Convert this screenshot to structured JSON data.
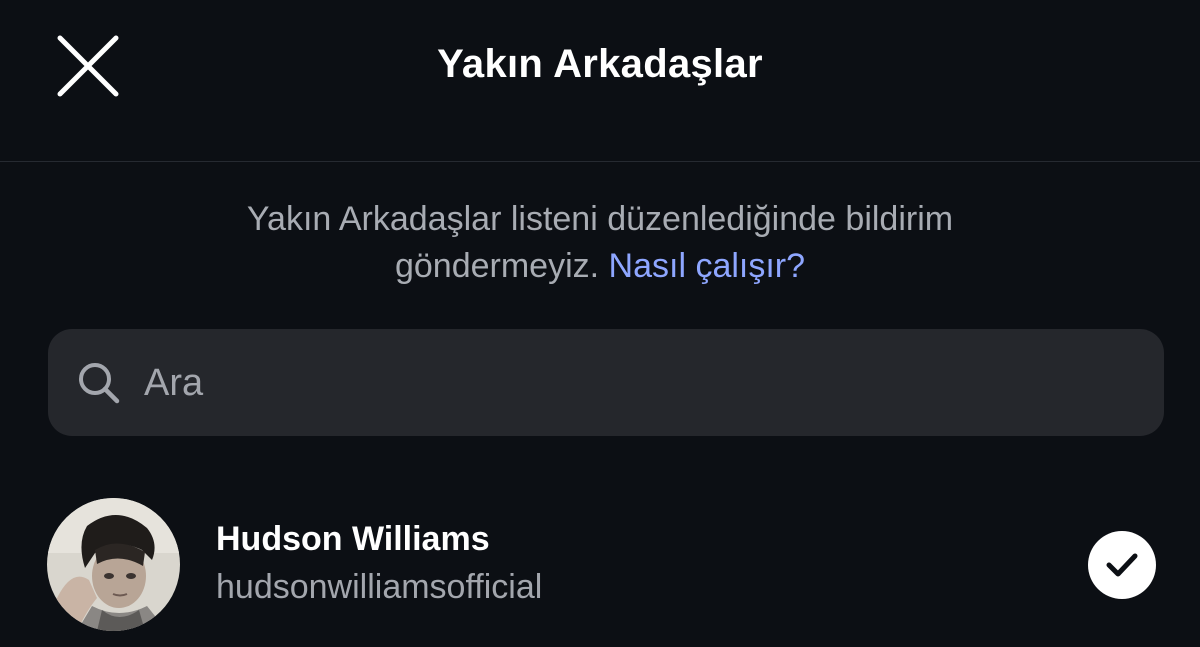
{
  "header": {
    "title": "Yakın Arkadaşlar",
    "close_icon": "close-icon"
  },
  "info": {
    "text": "Yakın Arkadaşlar listeni düzenlediğinde bildirim göndermeyiz.",
    "link": "Nasıl çalışır?"
  },
  "search": {
    "placeholder": "Ara",
    "icon": "search-icon"
  },
  "friends": [
    {
      "name": "Hudson Williams",
      "username": "hudsonwilliamsofficial",
      "selected": true,
      "check_icon": "check-icon"
    }
  ],
  "colors": {
    "background": "#0c0f14",
    "link": "#8ea6ff",
    "search_bg": "#25272c",
    "muted_text": "#a3a6ad"
  }
}
